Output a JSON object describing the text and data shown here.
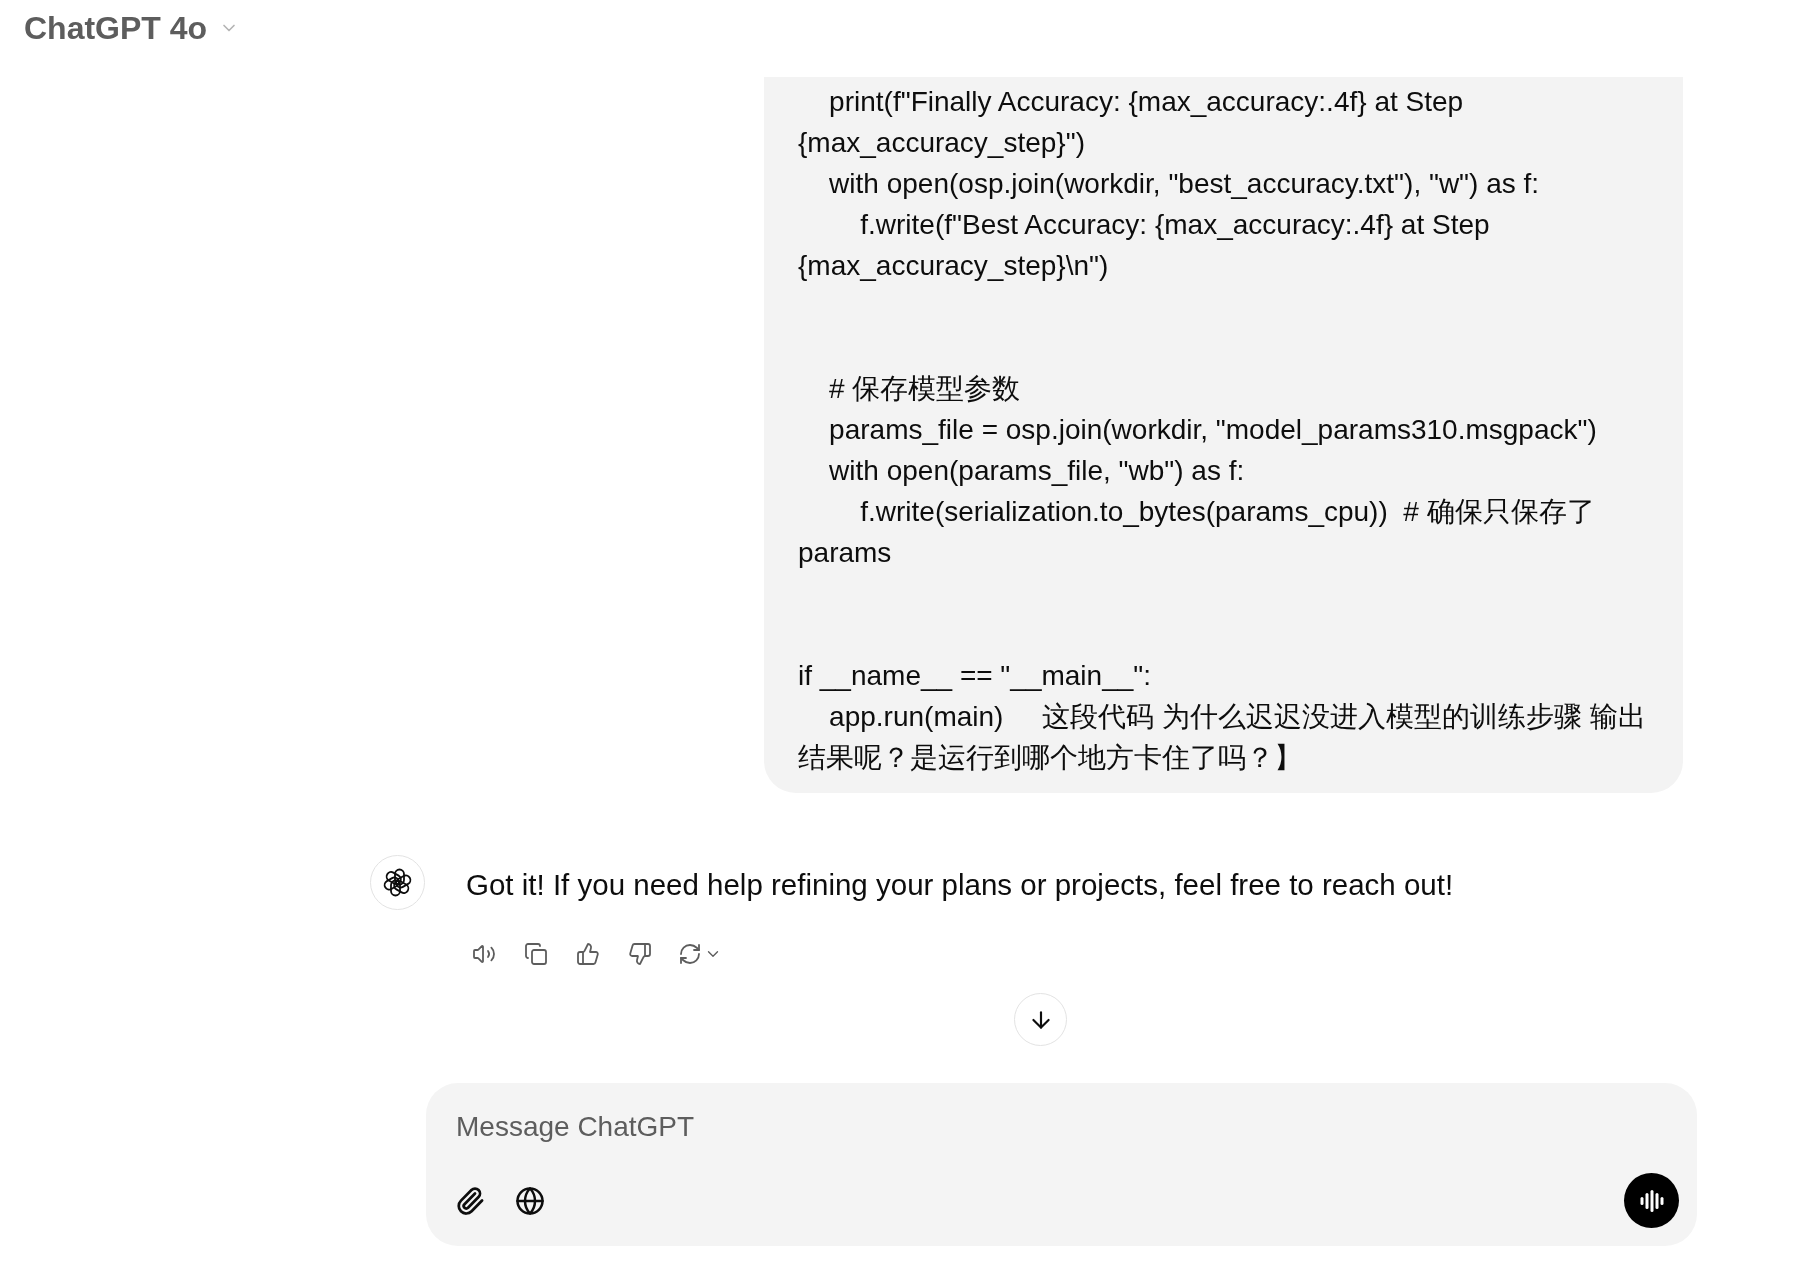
{
  "header": {
    "title": "ChatGPT 4o"
  },
  "user_message": {
    "blocks": [
      [
        "    print(f\"Finally Accuracy: {max_accuracy:.4f} at Step",
        "{max_accuracy_step}\")",
        "    with open(osp.join(workdir, \"best_accuracy.txt\"), \"w\") as f:",
        "        f.write(f\"Best Accuracy: {max_accuracy:.4f} at Step",
        "{max_accuracy_step}\\n\")"
      ],
      [
        "    # 保存模型参数",
        "    params_file = osp.join(workdir, \"model_params310.msgpack\")",
        "    with open(params_file, \"wb\") as f:",
        "        f.write(serialization.to_bytes(params_cpu))  # 确保只保存了",
        "params"
      ],
      [
        "if __name__ == \"__main__\":",
        "    app.run(main)     这段代码 为什么迟迟没进入模型的训练步骤 输出",
        "结果呢？是运行到哪个地方卡住了吗？】"
      ]
    ]
  },
  "assistant_message": {
    "text": "Got it! If you need help refining your plans or projects, feel free to reach out!"
  },
  "composer": {
    "placeholder": "Message ChatGPT"
  }
}
